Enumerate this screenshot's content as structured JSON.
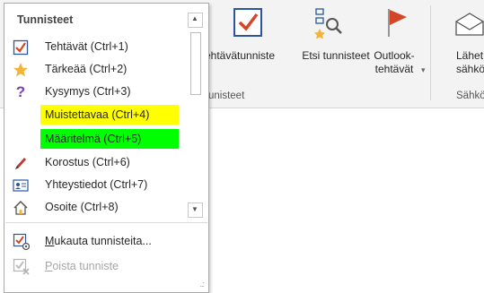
{
  "ribbon": {
    "buttons": [
      {
        "label": "ehtävätunniste",
        "icon": "check-tag-icon"
      },
      {
        "label": "Etsi tunnisteet",
        "icon": "find-tags-icon"
      },
      {
        "label": "Outlook-tehtävät",
        "dropdown_glyph": "▾",
        "icon": "flag-icon"
      },
      {
        "label": "Lähet sähköp",
        "icon": "envelope-icon"
      }
    ],
    "groups": [
      "unisteet",
      "Sähkö"
    ]
  },
  "menu": {
    "header": "Tunnisteet",
    "items": [
      {
        "label": "Tehtävät (Ctrl+1)",
        "icon": "checkbox-icon"
      },
      {
        "label": "Tärkeää (Ctrl+2)",
        "icon": "star-icon"
      },
      {
        "label": "Kysymys (Ctrl+3)",
        "icon": "question-icon"
      },
      {
        "label": "Muistettavaa (Ctrl+4)",
        "highlight": "#ffff00"
      },
      {
        "label": "Määritelmä (Ctrl+5)",
        "highlight": "#00ff00"
      },
      {
        "label": "Korostus (Ctrl+6)",
        "icon": "highlighter-icon"
      },
      {
        "label": "Yhteystiedot (Ctrl+7)",
        "icon": "contact-card-icon"
      },
      {
        "label": "Osoite (Ctrl+8)",
        "icon": "house-icon"
      }
    ],
    "commands": [
      {
        "label": "Mukauta tunnisteita...",
        "icon": "customize-tags-icon",
        "enabled": true
      },
      {
        "label": "Poista tunniste",
        "icon": "remove-tag-icon",
        "enabled": false
      }
    ],
    "scroll": {
      "up": "▲",
      "down": "▼"
    },
    "resize_grip": "..:"
  },
  "colors": {
    "accent_red": "#d24726",
    "highlight_yellow": "#ffff00",
    "highlight_green": "#00ff00",
    "check_blue": "#2b579a"
  }
}
